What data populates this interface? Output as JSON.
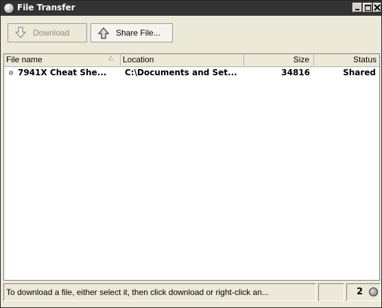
{
  "window": {
    "title": "File Transfer",
    "icon": "globe-icon"
  },
  "toolbar": {
    "download_label": "Download",
    "download_enabled": false,
    "download_icon": "arrow-down-icon",
    "share_label": "Share File...",
    "share_icon": "arrow-up-icon"
  },
  "table": {
    "columns": [
      "File name",
      "Location",
      "Size",
      "Status"
    ],
    "sort_column": "File name",
    "rows": [
      {
        "name": "7941X Cheat She...",
        "location": "C:\\Documents and Set...",
        "size": "34816",
        "status": "Shared",
        "icon": "file-share-icon"
      }
    ]
  },
  "statusbar": {
    "message": "To download a file, either select it, then click download or right-click an...",
    "count": "2",
    "network_icon": "network-status-icon"
  },
  "colors": {
    "titlebar": "#333333",
    "window_bg": "#ece9d8",
    "list_bg": "#ffffff"
  }
}
